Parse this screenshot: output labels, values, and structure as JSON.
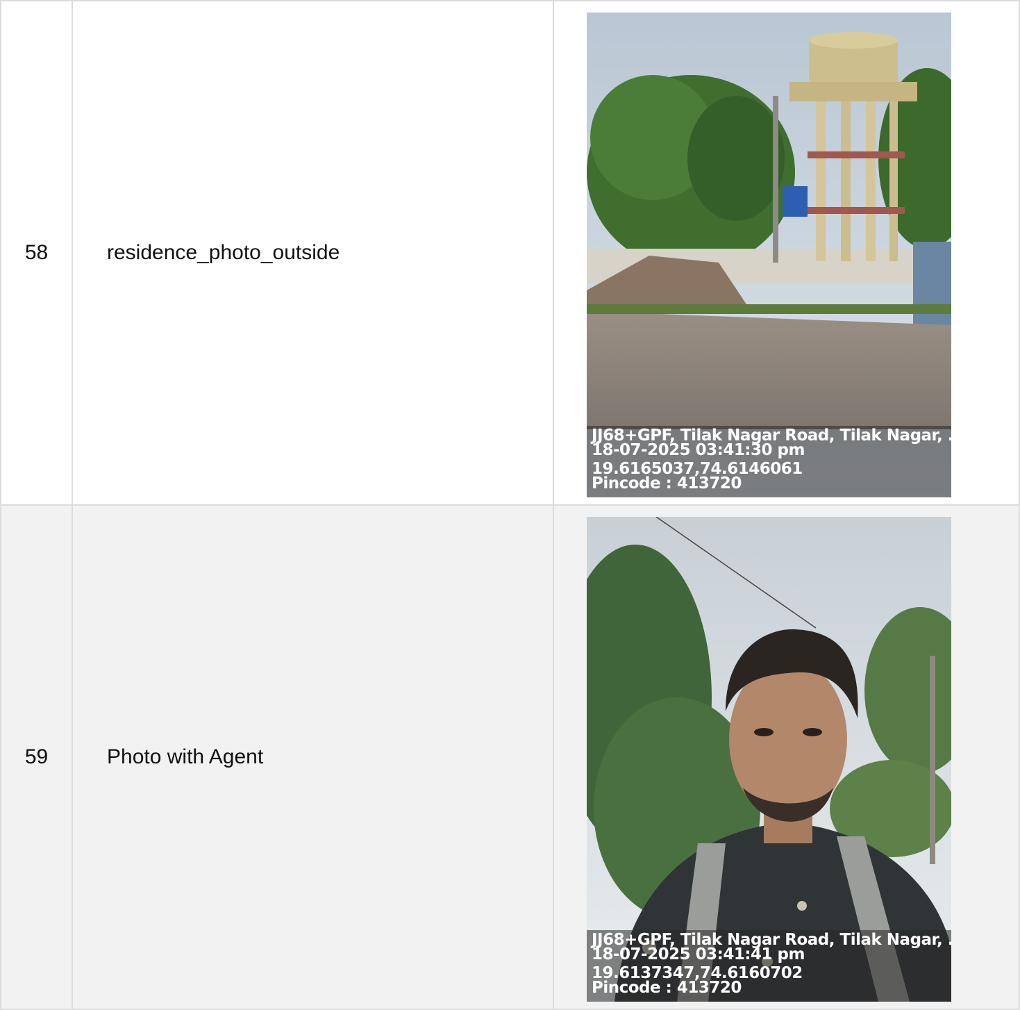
{
  "rows": [
    {
      "number": "58",
      "field": "residence_photo_outside",
      "photo": {
        "subject": "water tower and roadside",
        "stamp": {
          "address": "JJ68+GPF, Tilak Nagar Road, Tilak Nagar, ...",
          "datetime": "18-07-2025 03:41:30 pm",
          "coords": "19.6165037,74.6146061",
          "pincode": "Pincode : 413720"
        }
      }
    },
    {
      "number": "59",
      "field": "Photo with Agent",
      "photo": {
        "subject": "agent selfie outdoors",
        "stamp": {
          "address": "JJ68+GPF, Tilak Nagar Road, Tilak Nagar, ...",
          "datetime": "18-07-2025 03:41:41 pm",
          "coords": "19.6137347,74.6160702",
          "pincode": "Pincode : 413720"
        }
      }
    }
  ],
  "colors": {
    "border": "#dcdcdc",
    "row_alt_bg": "#f2f2f2",
    "stamp_text": "#ffffff"
  }
}
